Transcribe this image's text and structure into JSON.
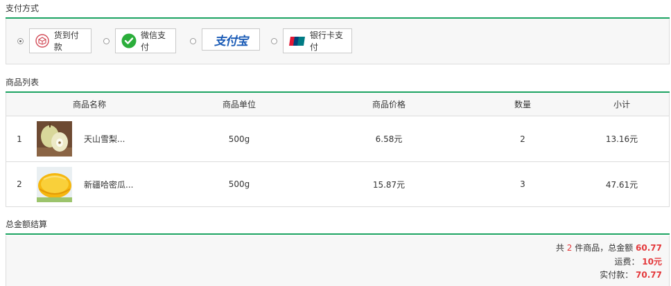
{
  "payment": {
    "section_title": "支付方式",
    "options": [
      {
        "label": "货到付款",
        "icon": "cash-on-delivery-icon",
        "selected": true
      },
      {
        "label": "微信支付",
        "icon": "wechat-pay-icon",
        "selected": false
      },
      {
        "label": "支付宝",
        "icon": "alipay-logo",
        "selected": false
      },
      {
        "label": "银行卡支付",
        "icon": "unionpay-icon",
        "selected": false
      }
    ]
  },
  "products": {
    "section_title": "商品列表",
    "headers": [
      "商品名称",
      "商品单位",
      "商品价格",
      "数量",
      "小计"
    ],
    "rows": [
      {
        "index": "1",
        "name": "天山雪梨...",
        "unit": "500g",
        "price": "6.58元",
        "qty": "2",
        "subtotal": "13.16元"
      },
      {
        "index": "2",
        "name": "新疆哈密瓜...",
        "unit": "500g",
        "price": "15.87元",
        "qty": "3",
        "subtotal": "47.61元"
      }
    ]
  },
  "summary": {
    "section_title": "总金额结算",
    "count_prefix": "共",
    "count": "2",
    "count_suffix": "件商品，总金额",
    "total": "60.77",
    "shipping_label": "运费：",
    "shipping": "10元",
    "paid_label": "实付款：",
    "paid": "70.77"
  },
  "colors": {
    "accent": "#1ba361",
    "price": "#e4393c",
    "panel": "#f7f7f7",
    "border": "#dcdcdc"
  }
}
